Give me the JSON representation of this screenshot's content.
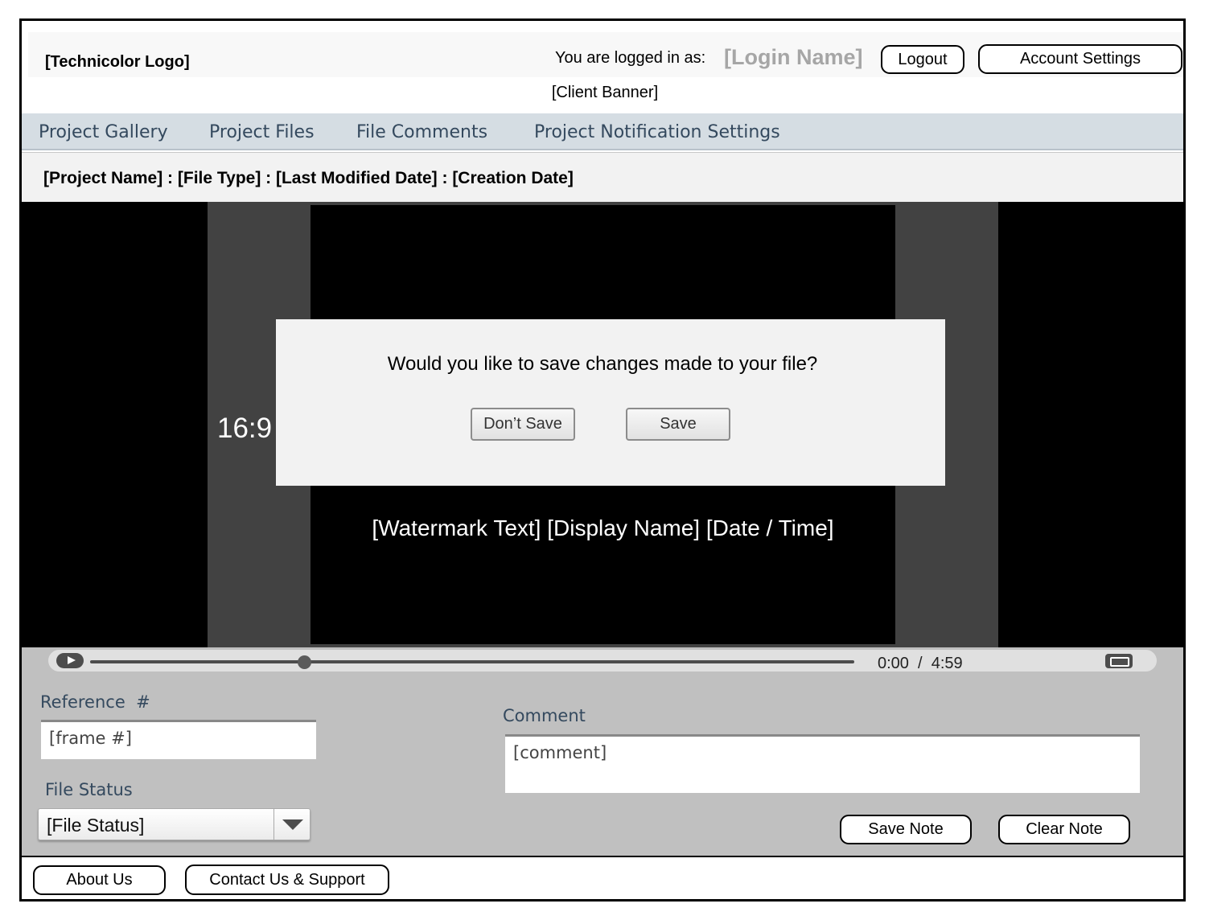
{
  "header": {
    "logo": "[Technicolor Logo]",
    "logged_in_label": "You are logged in as:",
    "login_name": "[Login Name]",
    "logout": "Logout",
    "account_settings": "Account Settings",
    "client_banner": "[Client Banner]"
  },
  "nav": {
    "items": [
      "Project Gallery",
      "Project Files",
      "File Comments",
      "Project Notification Settings"
    ]
  },
  "file_meta": "[Project Name] : [File Type] : [Last Modified Date] : [Creation Date]",
  "player": {
    "aspect_ratio": "16:9",
    "watermark": "[Watermark Text] [Display Name] [Date / Time]",
    "current_time": "0:00",
    "duration": "4:59",
    "progress_fraction": 0.28,
    "play_icon": "play-icon",
    "fullscreen_icon": "fullscreen-icon"
  },
  "dialog": {
    "message": "Would you like to save changes made to your file?",
    "dont_save": "Don’t Save",
    "save": "Save"
  },
  "form": {
    "reference_label": "Reference  #",
    "frame_value": "[frame #]",
    "file_status_label": "File Status",
    "file_status_value": "[File Status]",
    "comment_label": "Comment",
    "comment_value": "[comment]",
    "save_note": "Save Note",
    "clear_note": "Clear Note"
  },
  "footer": {
    "about": "About Us",
    "contact": "Contact Us & Support"
  },
  "colors": {
    "nav_bg": "#d5dde3",
    "nav_text": "#34495e",
    "panel_bg": "#c0c0c0",
    "login_name": "#a6a6a6",
    "pillarbox": "#424242",
    "dialog_bg": "#f2f2f2"
  }
}
